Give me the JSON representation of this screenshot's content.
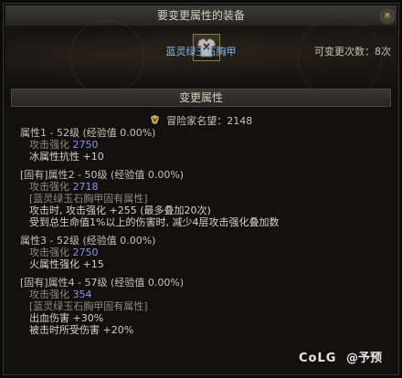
{
  "window": {
    "title": "要变更属性的装备",
    "close": "×"
  },
  "item": {
    "name": "蓝灵绿玉石胸甲",
    "change_count": "可变更次数：8次"
  },
  "section": {
    "title": "变更属性"
  },
  "renown": {
    "text": "冒险家名望：2148"
  },
  "attributes": [
    {
      "title": "属性1 - 52级 (经验值 0.00%)",
      "lines": [
        {
          "label": "攻击强化",
          "value": "2750"
        },
        {
          "text": "冰属性抗性 +10"
        }
      ]
    },
    {
      "title": "[固有]属性2 - 50级 (经验值 0.00%)",
      "lines": [
        {
          "label": "攻击强化",
          "value": "2718"
        },
        {
          "muted": "[蓝灵绿玉石胸甲固有属性]"
        },
        {
          "text": "攻击时, 攻击强化 +255 (最多叠加20次)"
        },
        {
          "text": "受到总生命值1%以上的伤害时, 减少4层攻击强化叠加数"
        }
      ]
    },
    {
      "title": "属性3 - 52级 (经验值 0.00%)",
      "lines": [
        {
          "label": "攻击强化",
          "value": "2750"
        },
        {
          "text": "火属性强化 +15"
        }
      ]
    },
    {
      "title": "[固有]属性4 - 57级 (经验值 0.00%)",
      "lines": [
        {
          "label": "攻击强化",
          "value": "354"
        },
        {
          "muted": "[蓝灵绿玉石胸甲固有属性]"
        },
        {
          "text": "出血伤害 +30%"
        },
        {
          "text": "被击时所受伤害 +20%"
        }
      ]
    }
  ],
  "watermark": {
    "logo": "CoLG",
    "handle": "@予预"
  },
  "colors": {
    "item_name": "#7fb6e8",
    "value_blue": "#8f8fe8",
    "icon_gold": "#d6b25a"
  }
}
